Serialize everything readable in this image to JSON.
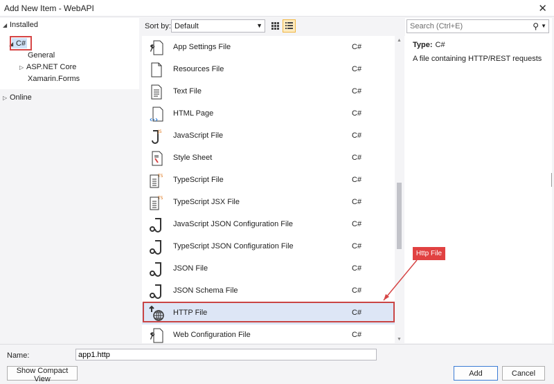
{
  "window": {
    "title": "Add New Item - WebAPI",
    "close_glyph": "✕"
  },
  "tree": {
    "installed": "Installed",
    "csharp": "C#",
    "children": [
      "General",
      "ASP.NET Core",
      "Xamarin.Forms"
    ],
    "online": "Online"
  },
  "toolbar": {
    "sort_label": "Sort by:",
    "sort_value": "Default",
    "views": [
      "grid-view-icon",
      "list-view-icon"
    ]
  },
  "items": [
    {
      "name": "App Settings File",
      "lang": "C#",
      "icon": "wrench-doc-icon"
    },
    {
      "name": "Resources File",
      "lang": "C#",
      "icon": "blank-doc-icon"
    },
    {
      "name": "Text File",
      "lang": "C#",
      "icon": "text-doc-icon"
    },
    {
      "name": "HTML Page",
      "lang": "C#",
      "icon": "html-doc-icon"
    },
    {
      "name": "JavaScript File",
      "lang": "C#",
      "icon": "js-doc-icon"
    },
    {
      "name": "Style Sheet",
      "lang": "C#",
      "icon": "css-doc-icon"
    },
    {
      "name": "TypeScript File",
      "lang": "C#",
      "icon": "ts-doc-icon"
    },
    {
      "name": "TypeScript JSX File",
      "lang": "C#",
      "icon": "tsx-doc-icon"
    },
    {
      "name": "JavaScript JSON Configuration File",
      "lang": "C#",
      "icon": "json-doc-icon"
    },
    {
      "name": "TypeScript JSON Configuration File",
      "lang": "C#",
      "icon": "json-doc-icon"
    },
    {
      "name": "JSON File",
      "lang": "C#",
      "icon": "json-doc-icon"
    },
    {
      "name": "JSON Schema File",
      "lang": "C#",
      "icon": "json-doc-icon"
    },
    {
      "name": "HTTP File",
      "lang": "C#",
      "icon": "http-globe-icon",
      "selected": true
    },
    {
      "name": "Web Configuration File",
      "lang": "C#",
      "icon": "wrench-doc-icon"
    }
  ],
  "details": {
    "search_placeholder": "Search (Ctrl+E)",
    "type_label": "Type:",
    "type_value": "C#",
    "description": "A file containing HTTP/REST requests"
  },
  "callout": {
    "text": "Http File",
    "color": "#e14141"
  },
  "footer": {
    "name_label": "Name:",
    "name_value": "app1.http",
    "compact_button": "Show Compact View",
    "add_button": "Add",
    "cancel_button": "Cancel"
  },
  "colors": {
    "accent": "#3a7bd5",
    "highlight": "#d64545",
    "selection": "#dde6f6"
  }
}
